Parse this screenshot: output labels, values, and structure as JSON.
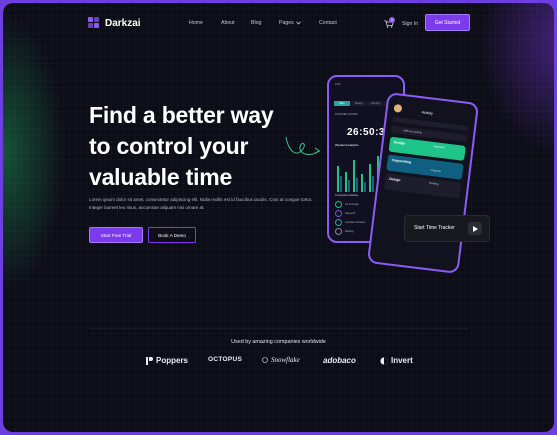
{
  "brand": {
    "name": "Darkzai",
    "accent": "#7c3aed",
    "background": "#0d0d18"
  },
  "nav": {
    "items": [
      {
        "label": "Home"
      },
      {
        "label": "About"
      },
      {
        "label": "Blog"
      },
      {
        "label": "Pages"
      },
      {
        "label": "Contact"
      }
    ],
    "cart_count": "0",
    "signin_label": "Sign In",
    "cta_label": "Get Started"
  },
  "hero": {
    "headline_line1": "Find a better way",
    "headline_line2": "to control your",
    "headline_line3": "valuable time",
    "description": "Lorem ipsum dolor sit amet, consectetur adipiscing elit. Nulla mollis est id faucibus iaculis. Cras at congue tortor. Integer laoreet leo risus, accumsan aliquam nisi ornare at.",
    "primary_button": "Start Free Trial",
    "secondary_button": "Book A Demo"
  },
  "phone_main": {
    "status": "9:41",
    "tabs": [
      "Daily",
      "Weekly",
      "Monthly",
      "Yearly"
    ],
    "tracked_label": "TRACKED HOURS",
    "timer": "26:50:32",
    "analytics_label": "Weekend analytics",
    "completed_label": "Completed activities",
    "activities": [
      "Go to Design",
      "Research",
      "Complete Activities",
      "Meeting"
    ]
  },
  "phone_activity": {
    "title": "Activity",
    "add_label": "Add new activity",
    "cards": [
      {
        "title": "Design",
        "tag": "Important"
      },
      {
        "title": "Copywriting",
        "tag": "Progress"
      },
      {
        "title": "Design",
        "tag": "Pending"
      }
    ]
  },
  "tracker": {
    "label": "Start Time Tracker",
    "icon": "play-icon"
  },
  "partners": {
    "title": "Used by amazing companies worldwide",
    "logos": [
      "Poppers",
      "OCTOPUS",
      "Snowflake",
      "adobaco",
      "Invert"
    ]
  }
}
